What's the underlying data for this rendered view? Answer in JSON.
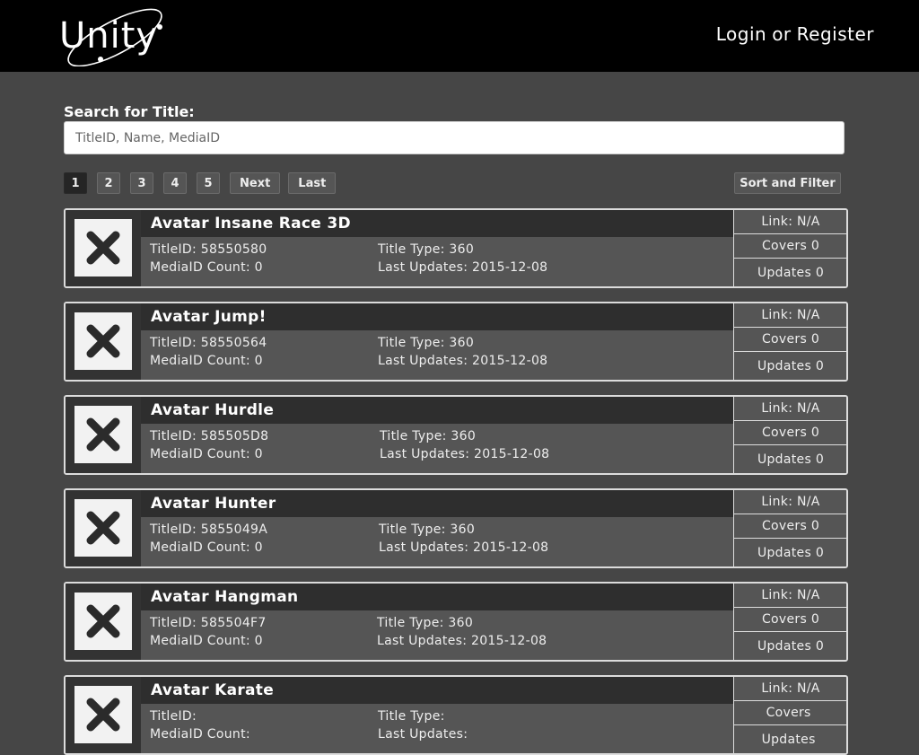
{
  "header": {
    "logo_text": "Unity",
    "login": "Login",
    "or": "or",
    "register": "Register"
  },
  "search": {
    "label": "Search for Title:",
    "placeholder": "TitleID, Name, MediaID",
    "value": ""
  },
  "pagination": {
    "pages": [
      "1",
      "2",
      "3",
      "4",
      "5"
    ],
    "active": "1",
    "next": "Next",
    "last": "Last"
  },
  "sort_filter_label": "Sort and Filter",
  "labels": {
    "title_id": "TitleID:",
    "media_id_count": "MediaID Count:",
    "title_type": "Title Type:",
    "last_updates": "Last Updates:",
    "link": "Link:",
    "covers": "Covers",
    "updates": "Updates"
  },
  "titles": [
    {
      "name": "Avatar Insane Race 3D",
      "title_id": "58550580",
      "media_id_count": "0",
      "title_type": "360",
      "last_updates": "2015-12-08",
      "link": "N/A",
      "covers": "0",
      "updates": "0"
    },
    {
      "name": "Avatar Jump!",
      "title_id": "58550564",
      "media_id_count": "0",
      "title_type": "360",
      "last_updates": "2015-12-08",
      "link": "N/A",
      "covers": "0",
      "updates": "0"
    },
    {
      "name": "Avatar Hurdle",
      "title_id": "585505D8",
      "media_id_count": "0",
      "title_type": "360",
      "last_updates": "2015-12-08",
      "link": "N/A",
      "covers": "0",
      "updates": "0"
    },
    {
      "name": "Avatar Hunter",
      "title_id": "5855049A",
      "media_id_count": "0",
      "title_type": "360",
      "last_updates": "2015-12-08",
      "link": "N/A",
      "covers": "0",
      "updates": "0"
    },
    {
      "name": "Avatar Hangman",
      "title_id": "585504F7",
      "media_id_count": "0",
      "title_type": "360",
      "last_updates": "2015-12-08",
      "link": "N/A",
      "covers": "0",
      "updates": "0"
    },
    {
      "name": "Avatar Karate",
      "title_id": "",
      "media_id_count": "",
      "title_type": "",
      "last_updates": "",
      "link": "N/A",
      "covers": "",
      "updates": ""
    }
  ]
}
